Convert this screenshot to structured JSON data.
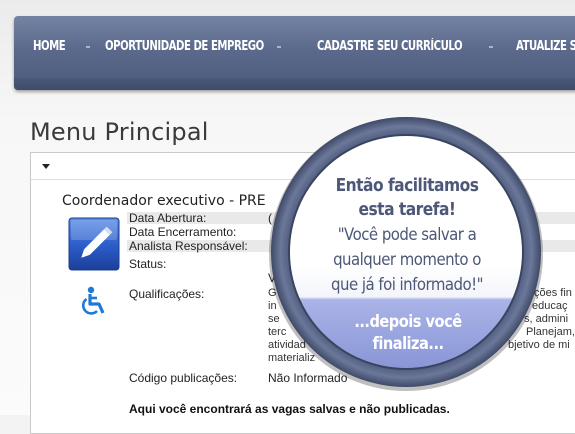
{
  "nav": {
    "items": [
      {
        "label": "HOME"
      },
      {
        "label": "OPORTUNIDADE DE EMPREGO"
      },
      {
        "label": "CADASTRE SEU CURRÍCULO"
      },
      {
        "label": "ATUALIZE S"
      }
    ]
  },
  "page": {
    "title": "Menu Principal"
  },
  "job": {
    "title": "Coordenador executivo  -  PRE",
    "fields": {
      "data_abertura": {
        "label": "Data Abertura:",
        "value": "("
      },
      "data_encerramento": {
        "label": "Data Encerramento:",
        "value": ""
      },
      "analista": {
        "label": "Analista Responsável:",
        "value": ""
      },
      "status": {
        "label": "Status:",
        "value": "V"
      },
      "qualificacoes": {
        "label": "Qualificações:",
        "lines": [
          "G",
          "in",
          "se",
          "terc",
          "atividad",
          "materializ"
        ],
        "right_fragments": [
          "ções fin",
          "educaç",
          "s, admini",
          "Planejam,",
          "bjetivo de mi"
        ]
      },
      "codigo": {
        "label": "Código publicações:",
        "value": "Não Informado"
      }
    },
    "note": "Aqui você encontrará as vagas salvas e não publicadas."
  },
  "callout": {
    "headline": [
      "Então facilitamos",
      "esta tarefa!"
    ],
    "quote": [
      "\"Você pode salvar a",
      "qualquer momento o",
      "que já foi informado!\""
    ],
    "sub": [
      "...depois você",
      "finaliza..."
    ]
  },
  "colors": {
    "nav_bg": "#5b6a8c",
    "callout_ring": "#5d6a8b",
    "callout_text": "#4d5878",
    "callout_lower": "#8f9cd6"
  },
  "icons": {
    "edit": "pencil-edit-icon",
    "accessibility": "wheelchair-icon",
    "expand": "caret-down-icon"
  }
}
